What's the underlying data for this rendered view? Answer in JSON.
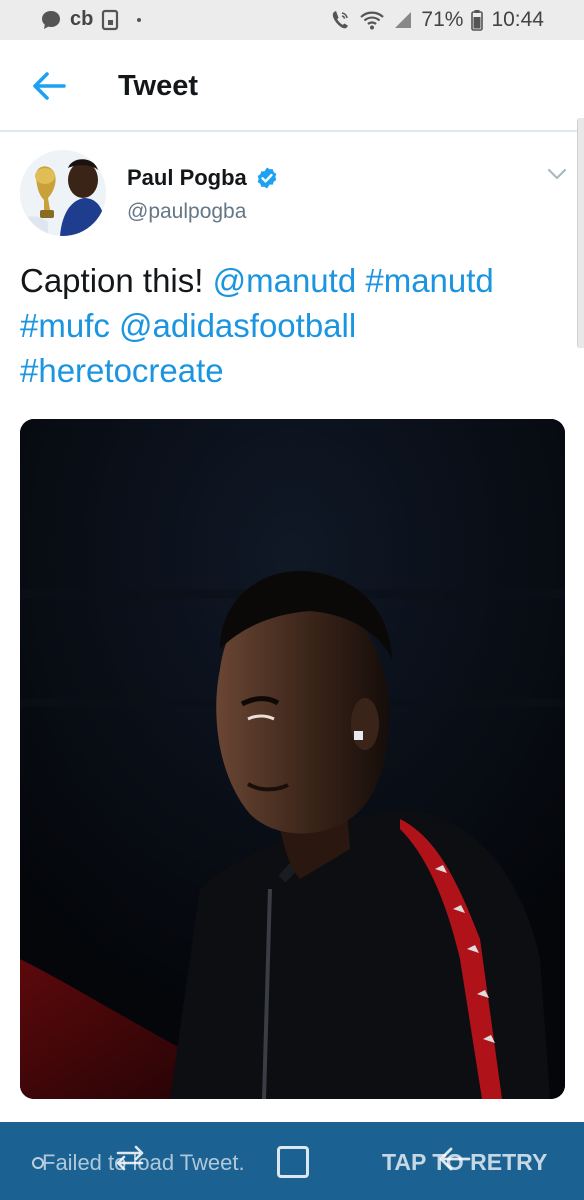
{
  "status_bar": {
    "carrier": "cb",
    "battery_percent": "71%",
    "time": "10:44"
  },
  "header": {
    "title": "Tweet"
  },
  "tweet": {
    "author_name": "Paul Pogba",
    "author_handle": "@paulpogba",
    "text_parts": [
      {
        "text": "Caption this! ",
        "link": false
      },
      {
        "text": "@manutd",
        "link": true
      },
      {
        "text": " ",
        "link": false
      },
      {
        "text": "#manutd",
        "link": true
      },
      {
        "text": " ",
        "link": false
      },
      {
        "text": "#mufc",
        "link": true
      },
      {
        "text": " ",
        "link": false
      },
      {
        "text": "@adidasfootball",
        "link": true
      },
      {
        "text": " ",
        "link": false
      },
      {
        "text": "#heretocreate",
        "link": true
      }
    ]
  },
  "bottom_bar": {
    "message": "Failed to load Tweet.",
    "action": "TAP TO RETRY"
  },
  "colors": {
    "link": "#1b95e0",
    "verified": "#1da1f2",
    "bar": "#1b6192"
  }
}
